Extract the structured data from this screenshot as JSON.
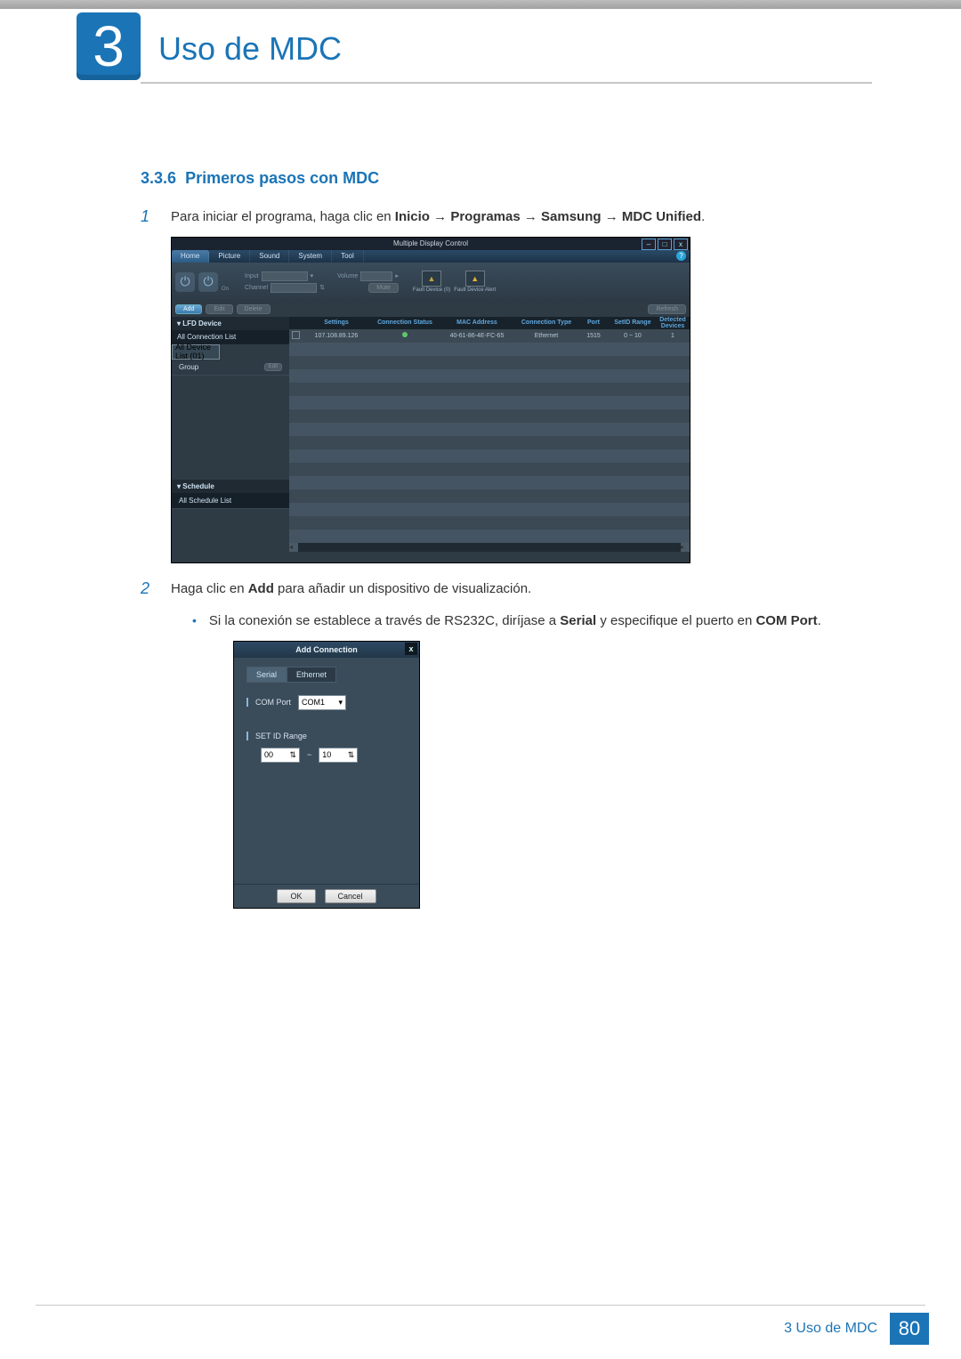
{
  "chapter": {
    "number": "3",
    "title": "Uso de MDC"
  },
  "section": {
    "number": "3.3.6",
    "title": "Primeros pasos con MDC"
  },
  "step1": {
    "num": "1",
    "pre": "Para iniciar el programa, haga clic en ",
    "path": [
      "Inicio",
      "Programas",
      "Samsung",
      "MDC Unified"
    ],
    "arrow": " → "
  },
  "mdc": {
    "title": "Multiple Display Control",
    "menu": [
      "Home",
      "Picture",
      "Sound",
      "System",
      "Tool"
    ],
    "help": "?",
    "win": {
      "min": "–",
      "max": "□",
      "close": "x"
    },
    "toolbar": {
      "on": "On",
      "off": "Off",
      "input_lbl": "Input",
      "channel_lbl": "Channel",
      "volume_lbl": "Volume",
      "mute_lbl": "Mute",
      "fault0": "Fault Device (0)",
      "faultAlert": "Fault Device Alert",
      "tri": "▲"
    },
    "buttons": {
      "add": "Add",
      "edit": "Edit",
      "delete": "Delete",
      "refresh": "Refresh"
    },
    "side": {
      "lfd": "LFD Device",
      "allconn": "All Connection List",
      "alldev": "All Device List (01)",
      "group": "Group",
      "editLbl": "Edit",
      "schedule": "Schedule",
      "allsched": "All Schedule List"
    },
    "cols": [
      "",
      "Settings",
      "Connection Status",
      "MAC Address",
      "Connection Type",
      "Port",
      "SetID Range",
      "Detected Devices"
    ],
    "row": {
      "settings": "107.108.89.126",
      "mac": "40-61-86-4E-FC-65",
      "ctype": "Ethernet",
      "port": "1515",
      "range": "0 ~ 10",
      "detected": "1"
    }
  },
  "step2": {
    "num": "2",
    "pre": "Haga clic en ",
    "bold1": "Add",
    "post": " para añadir un dispositivo de visualización."
  },
  "sub": {
    "pre": "Si la conexión se establece a través de RS232C, diríjase a ",
    "serial": "Serial",
    "mid": " y especifique el puerto en ",
    "com": "COM Port",
    "dot": "."
  },
  "dialog": {
    "title": "Add Connection",
    "tabs": {
      "serial": "Serial",
      "ethernet": "Ethernet"
    },
    "comport_lbl": "COM Port",
    "comport_val": "COM1",
    "setid_lbl": "SET ID Range",
    "from": "00",
    "sep": "~",
    "to": "10",
    "ok": "OK",
    "cancel": "Cancel",
    "x": "x",
    "chev": "▾",
    "ud": "⇅"
  },
  "footer": {
    "text": "3 Uso de MDC",
    "page": "80"
  }
}
